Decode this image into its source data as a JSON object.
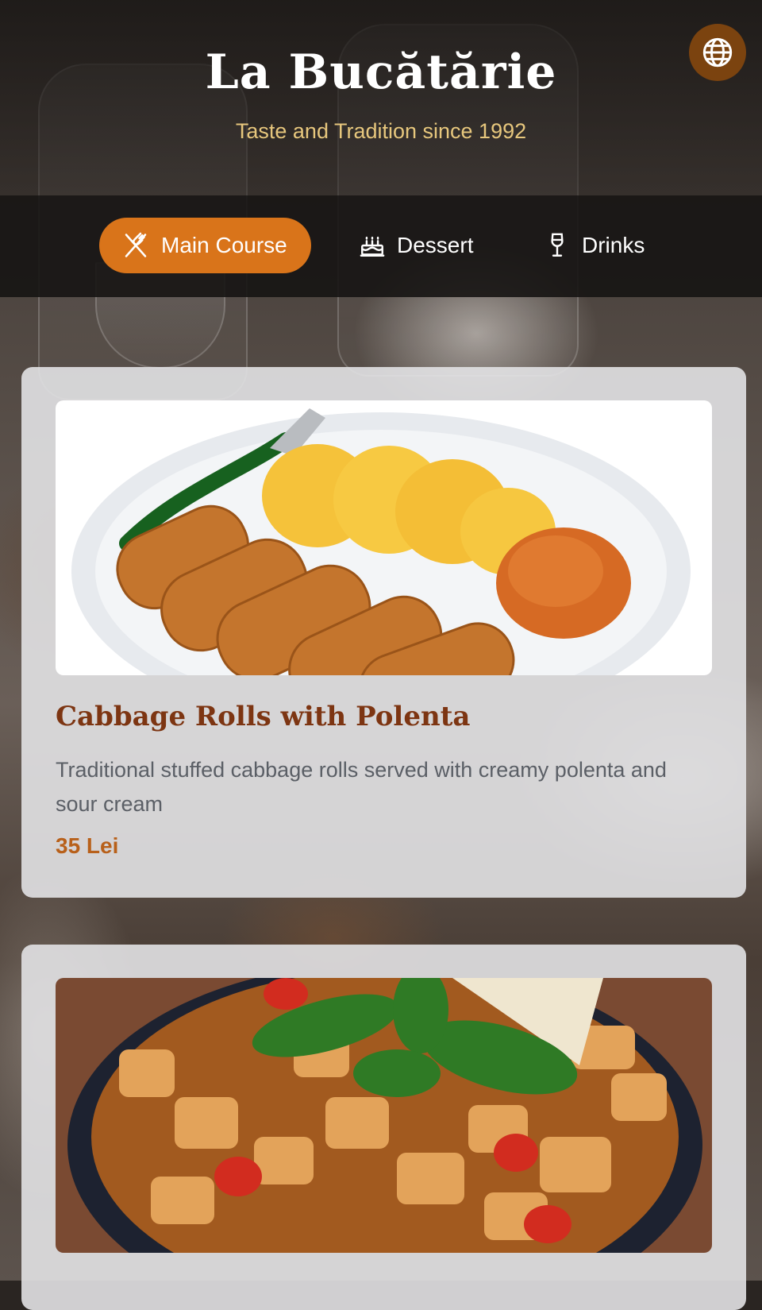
{
  "header": {
    "title": "La Bucătărie",
    "subtitle": "Taste and Tradition since 1992",
    "language_icon": "globe-icon"
  },
  "tabs": [
    {
      "label": "Main Course",
      "icon": "utensils-icon",
      "active": true
    },
    {
      "label": "Dessert",
      "icon": "cake-icon",
      "active": false
    },
    {
      "label": "Drinks",
      "icon": "wine-glass-icon",
      "active": false
    }
  ],
  "menu_items": [
    {
      "name": "Cabbage Rolls with Polenta",
      "description": "Traditional stuffed cabbage rolls served with creamy polenta and sour cream",
      "price": "35 Lei"
    },
    {}
  ],
  "colors": {
    "accent": "#d9741a",
    "title_brown": "#7d3512",
    "price": "#b8601a",
    "subtitle_gold": "#e7c77d",
    "globe_button": "#7b430f"
  }
}
